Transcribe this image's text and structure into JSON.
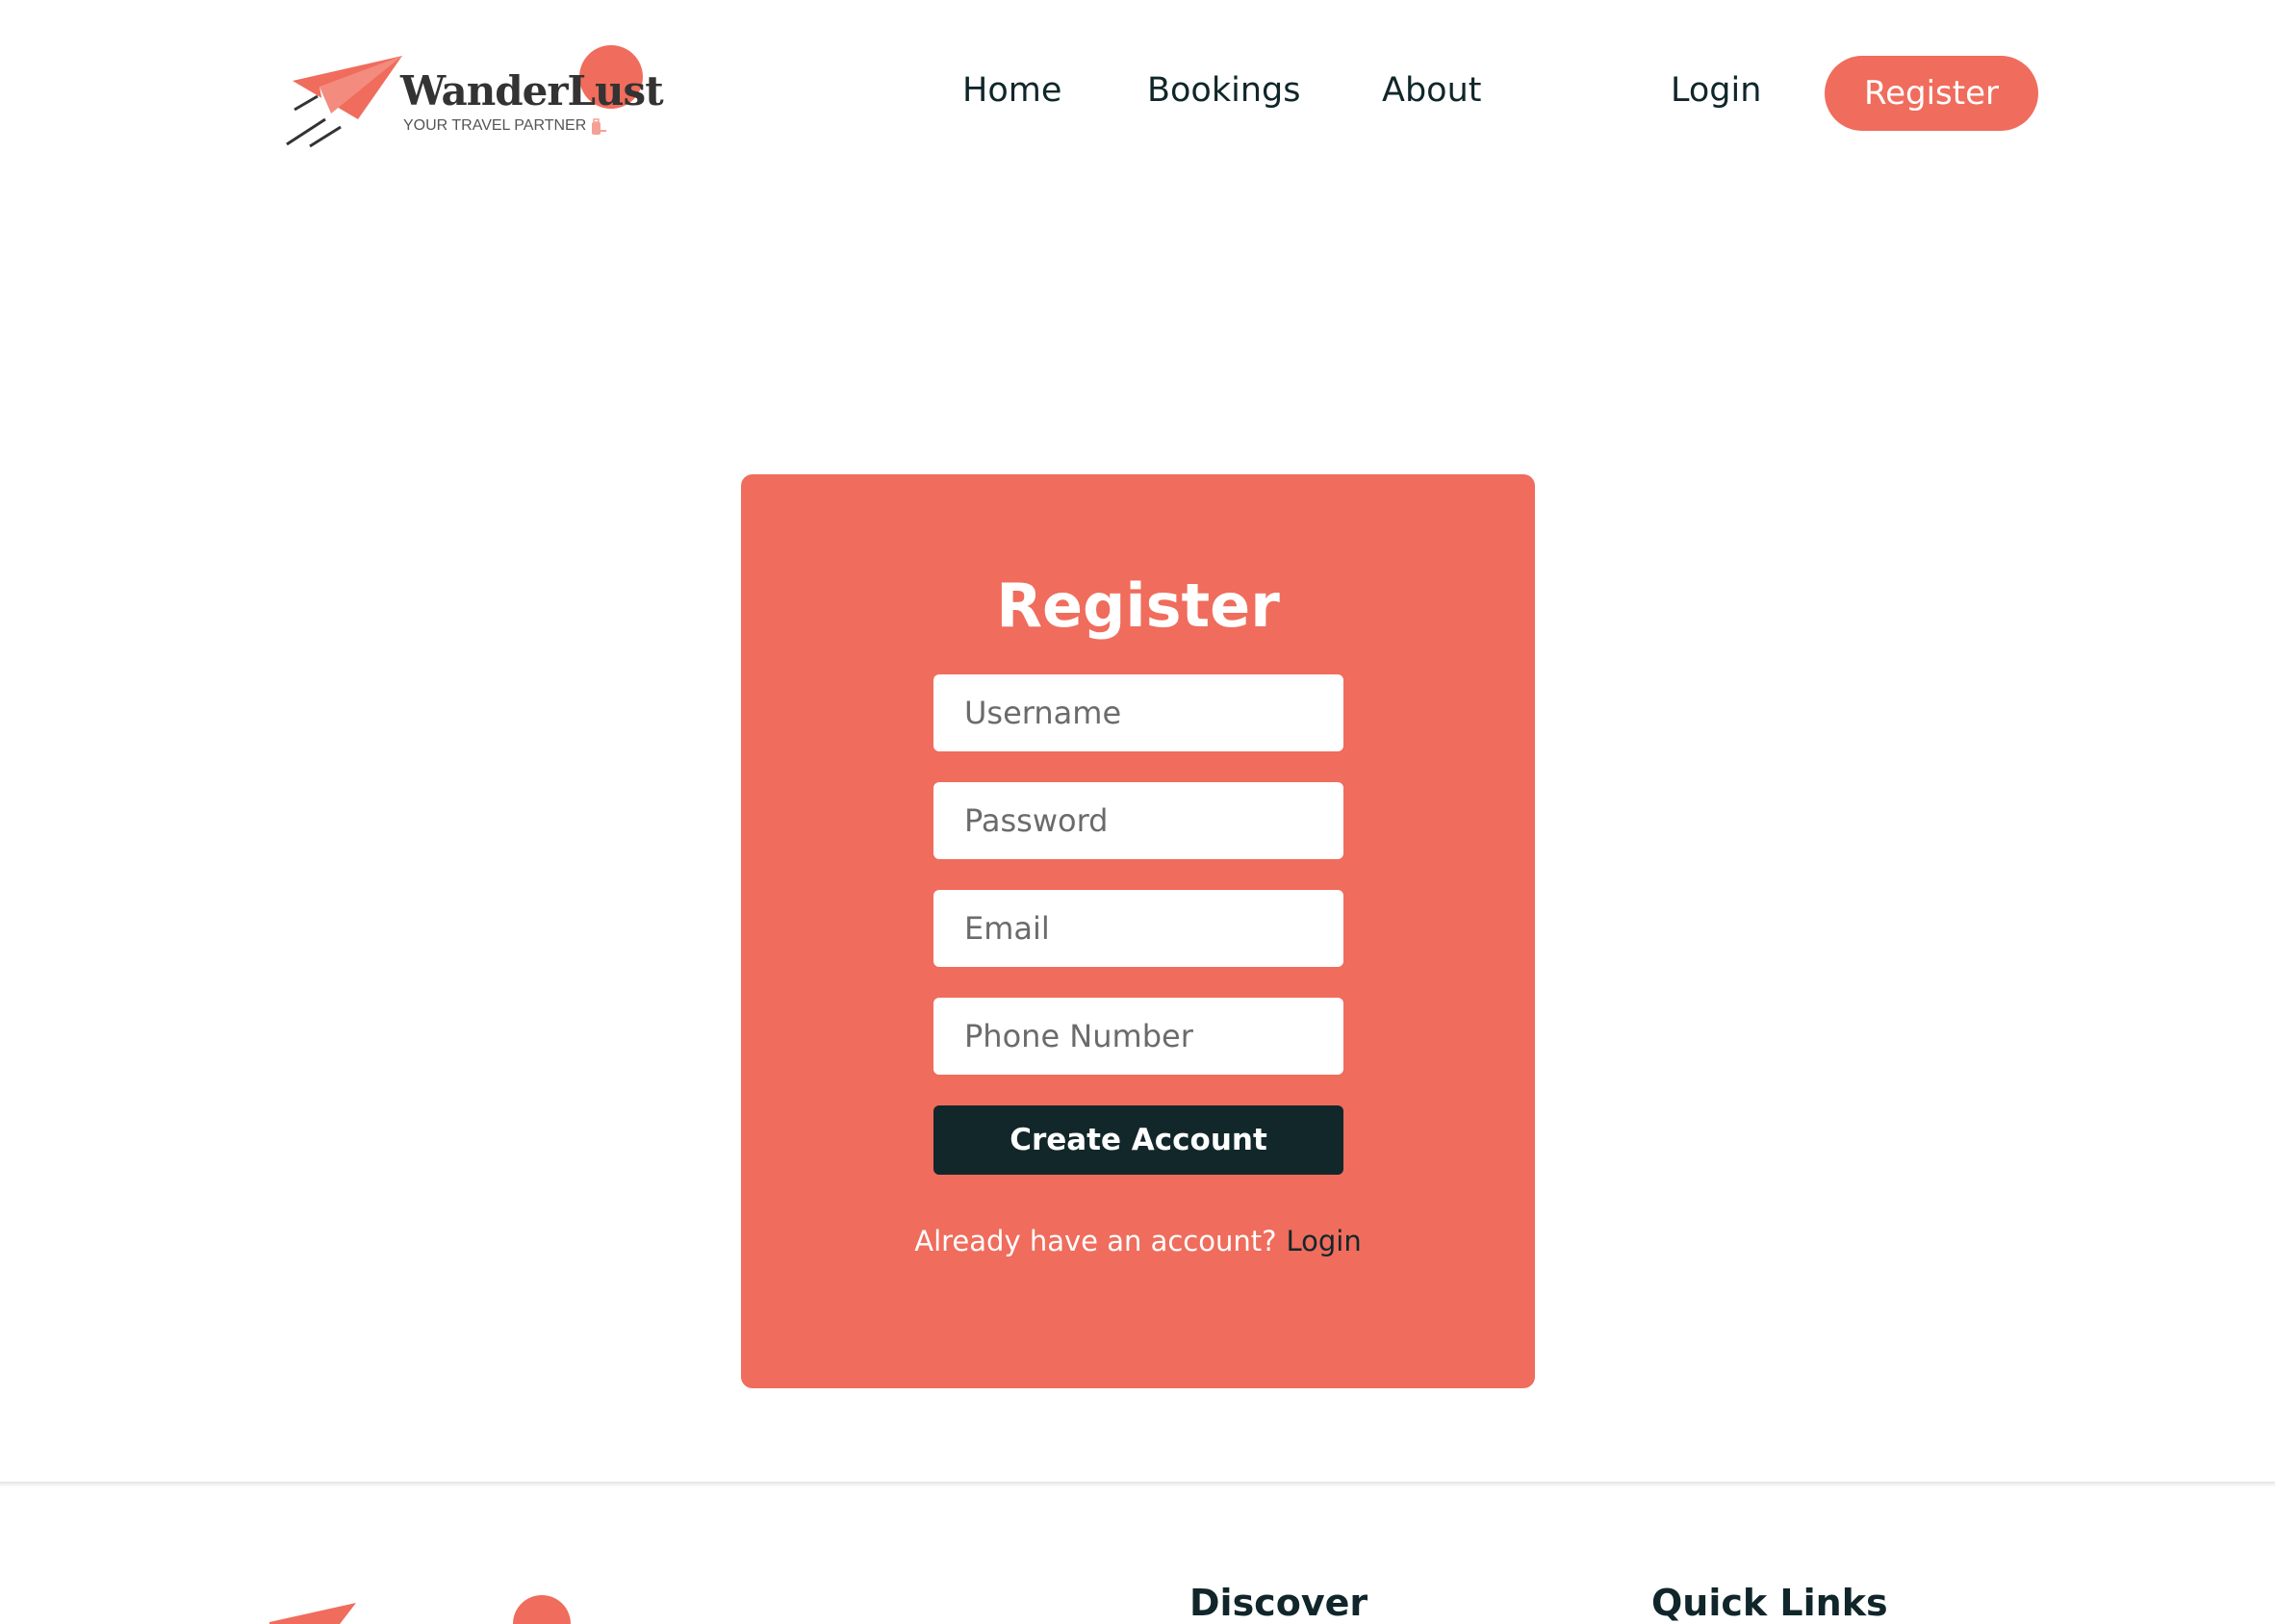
{
  "brand": {
    "name": "WanderLust",
    "tagline": "YOUR TRAVEL PARTNER",
    "accent_color": "#f06c5c",
    "dark_color": "#12272a"
  },
  "nav": {
    "links": [
      "Home",
      "Bookings",
      "About"
    ],
    "login_label": "Login",
    "register_label": "Register"
  },
  "register_form": {
    "title": "Register",
    "fields": [
      {
        "placeholder": "Username",
        "value": ""
      },
      {
        "placeholder": "Password",
        "value": ""
      },
      {
        "placeholder": "Email",
        "value": ""
      },
      {
        "placeholder": "Phone Number",
        "value": ""
      }
    ],
    "submit_label": "Create Account",
    "already_text": "Already have an account?",
    "login_link": "Login"
  },
  "footer": {
    "headings": [
      "Discover",
      "Quick Links"
    ]
  },
  "icons": [
    "paper-plane-icon",
    "sun-circle-icon",
    "suitcase-icon"
  ]
}
